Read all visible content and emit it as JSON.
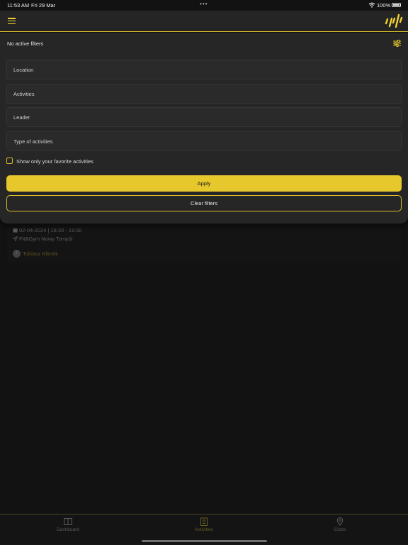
{
  "status_bar": {
    "time": "11:53 AM",
    "date": "Fri 29 Mar",
    "battery": "100%"
  },
  "header": {
    "menu_icon": "hamburger-menu-icon",
    "logo_icon": "brand-logo-icon",
    "accent_color": "#e6c82c"
  },
  "filters": {
    "status": "No active filters",
    "location_placeholder": "Location",
    "activities_placeholder": "Activities",
    "leader_placeholder": "Leader",
    "type_placeholder": "Type of activities",
    "favorites_label": "Show only your favorite activities",
    "favorites_checked": false,
    "apply_label": "Apply",
    "clear_label": "Clear filters"
  },
  "activity_card": {
    "datetime": "02-04-2024 | 18:30 - 19:30",
    "location": "Fit&Gym Nowy Tomyśl",
    "leader_initial": "T",
    "leader_name": "Tobiasz Klimek"
  },
  "bottom_nav": {
    "tabs": [
      {
        "label": "Dashboard",
        "icon": "book-icon",
        "active": false
      },
      {
        "label": "Activities",
        "icon": "calendar-icon",
        "active": true
      },
      {
        "label": "Clubs",
        "icon": "map-pin-icon",
        "active": false
      }
    ]
  }
}
